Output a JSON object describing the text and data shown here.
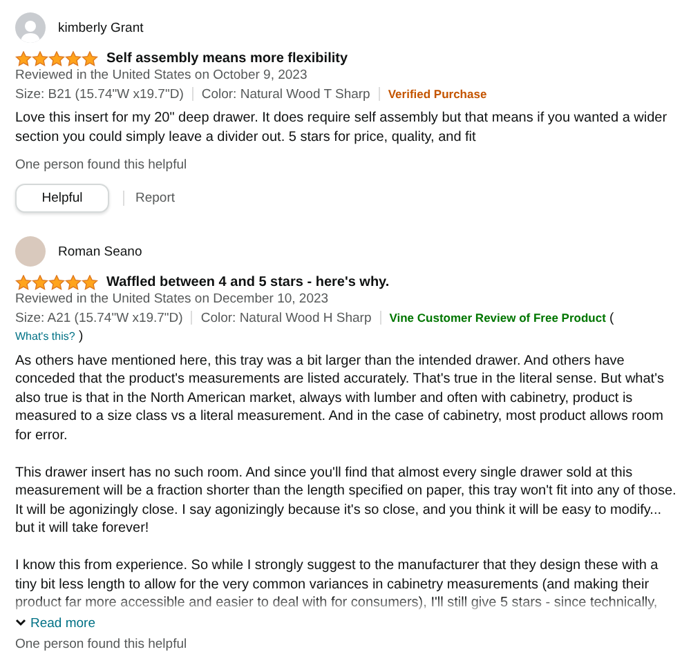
{
  "reviews": [
    {
      "author": "kimberly Grant",
      "kind": "silhouette",
      "stars": 5,
      "title": "Self assembly means more flexibility",
      "reviewed": "Reviewed in the United States on October 9, 2023",
      "size": "Size: B21 (15.74\"W x19.7\"D)",
      "variant": "Color: Natural Wood T Sharp",
      "badge": {
        "kind": "verified",
        "text": "Verified Purchase"
      },
      "paragraphs": [
        "Love this insert for my 20\" deep drawer. It does require self assembly but that means if you wanted a wider section you could simply leave a divider out. 5 stars for price, quality, and fit"
      ],
      "truncated": false,
      "helpful_count": "One person found this helpful",
      "actions": {
        "helpful": "Helpful",
        "report": "Report"
      }
    },
    {
      "author": "Roman Seano",
      "kind": "photo",
      "stars": 5,
      "title": "Waffled between 4 and 5 stars - here's why.",
      "reviewed": "Reviewed in the United States on December 10, 2023",
      "size": "Size: A21 (15.74\"W x19.7\"D)",
      "variant": "Color: Natural Wood H Sharp",
      "badge": {
        "kind": "vine",
        "text": "Vine Customer Review of Free Product",
        "open": "(",
        "link": "What's this?",
        "close": ")"
      },
      "paragraphs": [
        "As others have mentioned here, this tray was a bit larger than the intended drawer. And others have conceded that the product's measurements are listed accurately. That's true in the literal sense. But what's also true is that in the North American market, always with lumber and often with cabinetry, product is measured to a size class vs a literal measurement. And in the case of cabinetry, most product allows room for error.",
        "This drawer insert has no such room. And since you'll find that almost every single drawer sold at this measurement will be a fraction shorter than the length specified on paper, this tray won't fit into any of those. It will be agonizingly close. I say agonizingly because it's so close, and you think it will be easy to modify... but it will take forever!",
        "I know this from experience. So while I strongly suggest to the manufacturer that they design these with a tiny bit less length to allow for the very common variances in cabinetry measurements (and making their product far more accessible and easier to deal with for consumers), I'll still give 5 stars - since technically,"
      ],
      "truncated": true,
      "read_more": "Read more",
      "helpful_count": "One person found this helpful"
    }
  ]
}
